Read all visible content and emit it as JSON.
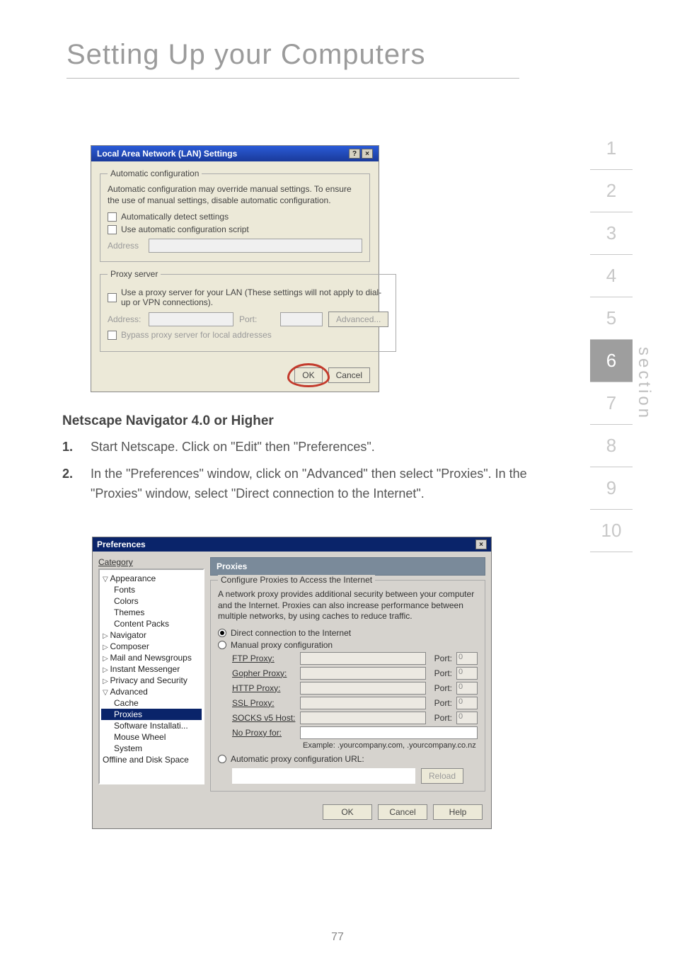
{
  "page": {
    "title": "Setting Up your Computers",
    "number": "77"
  },
  "section_nav": {
    "items": [
      "1",
      "2",
      "3",
      "4",
      "5",
      "6",
      "7",
      "8",
      "9",
      "10"
    ],
    "active_index": 5,
    "label": "section"
  },
  "lan_dialog": {
    "title": "Local Area Network (LAN) Settings",
    "auto_legend": "Automatic configuration",
    "auto_text": "Automatic configuration may override manual settings.  To ensure the use of manual settings, disable automatic configuration.",
    "auto_detect": "Automatically detect settings",
    "auto_script": "Use automatic configuration script",
    "address_label": "Address",
    "proxy_legend": "Proxy server",
    "proxy_text": "Use a proxy server for your LAN (These settings will not apply to dial-up or VPN connections).",
    "addr2_label": "Address:",
    "port_label": "Port:",
    "advanced": "Advanced...",
    "bypass": "Bypass proxy server for local addresses",
    "ok": "OK",
    "cancel": "Cancel"
  },
  "body": {
    "heading": "Netscape Navigator 4.0 or Higher",
    "step1_n": "1.",
    "step1_t": "Start Netscape. Click on \"Edit\" then \"Preferences\".",
    "step2_n": "2.",
    "step2_t": "In the \"Preferences\" window, click on \"Advanced\" then select \"Proxies\". In the \"Proxies\" window, select \"Direct connection to the Internet\"."
  },
  "pref_dialog": {
    "title": "Preferences",
    "category_label": "Category",
    "tree": {
      "appearance": "Appearance",
      "fonts": "Fonts",
      "colors": "Colors",
      "themes": "Themes",
      "content_packs": "Content Packs",
      "navigator": "Navigator",
      "composer": "Composer",
      "mail": "Mail and Newsgroups",
      "im": "Instant Messenger",
      "privacy": "Privacy and Security",
      "advanced": "Advanced",
      "cache": "Cache",
      "proxies": "Proxies",
      "software": "Software Installati...",
      "mouse": "Mouse Wheel",
      "system": "System",
      "offline": "Offline and Disk Space"
    },
    "panel_title": "Proxies",
    "fieldset_legend": "Configure Proxies to Access the Internet",
    "desc": "A network proxy provides additional security between your computer and the Internet. Proxies can also increase performance between multiple networks, by using caches to reduce traffic.",
    "radio_direct": "Direct connection to the Internet",
    "radio_manual": "Manual proxy configuration",
    "ftp": "FTP Proxy:",
    "gopher": "Gopher Proxy:",
    "http": "HTTP Proxy:",
    "ssl": "SSL Proxy:",
    "socks": "SOCKS v5 Host:",
    "noproxy": "No Proxy for:",
    "port": "Port:",
    "port_ph": "0",
    "example": "Example:  .yourcompany.com, .yourcompany.co.nz",
    "radio_auto_url": "Automatic proxy configuration URL:",
    "reload": "Reload",
    "ok": "OK",
    "cancel": "Cancel",
    "help": "Help"
  }
}
